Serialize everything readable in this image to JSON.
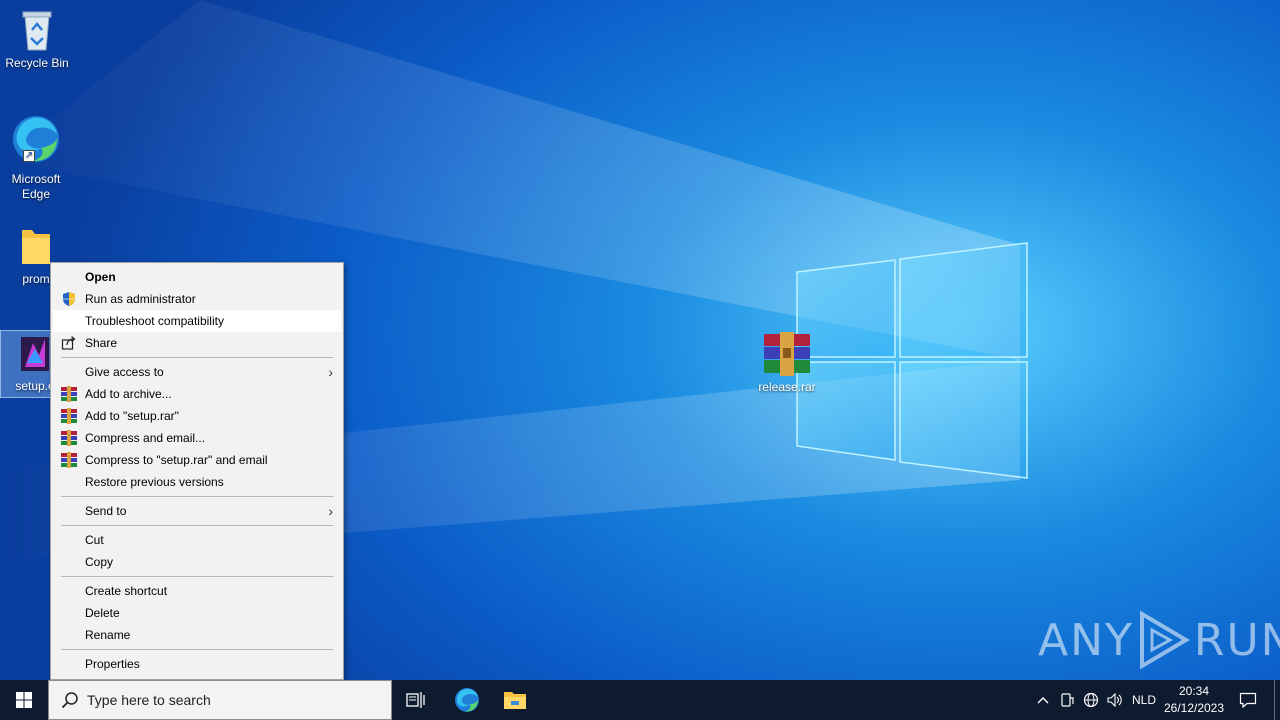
{
  "desktop": {
    "icons": [
      {
        "label": "Recycle Bin"
      },
      {
        "label": "Microsoft Edge"
      },
      {
        "label": "prom"
      },
      {
        "label": "setup.e"
      },
      {
        "label": "release.rar"
      }
    ]
  },
  "context_menu": {
    "items": [
      {
        "label": "Open",
        "icon": null
      },
      {
        "label": "Run as administrator",
        "icon": "uac-shield-icon"
      },
      {
        "label": "Troubleshoot compatibility",
        "icon": null,
        "highlighted": true
      },
      {
        "label": "Share",
        "icon": "share-icon"
      },
      {
        "label": "Give access to",
        "icon": null,
        "submenu": true
      },
      {
        "label": "Add to archive...",
        "icon": "winrar-icon"
      },
      {
        "label": "Add to \"setup.rar\"",
        "icon": "winrar-icon"
      },
      {
        "label": "Compress and email...",
        "icon": "winrar-icon"
      },
      {
        "label": "Compress to \"setup.rar\" and email",
        "icon": "winrar-icon"
      },
      {
        "label": "Restore previous versions",
        "icon": null
      },
      {
        "label": "Send to",
        "icon": null,
        "submenu": true
      },
      {
        "label": "Cut",
        "icon": null
      },
      {
        "label": "Copy",
        "icon": null
      },
      {
        "label": "Create shortcut",
        "icon": null
      },
      {
        "label": "Delete",
        "icon": null
      },
      {
        "label": "Rename",
        "icon": null
      },
      {
        "label": "Properties",
        "icon": null
      }
    ],
    "submenu_arrow": "›"
  },
  "taskbar": {
    "search_placeholder": "Type here to search",
    "language": "NLD",
    "time": "20:34",
    "date": "26/12/2023"
  },
  "watermark": {
    "text_left": "ANY",
    "text_right": "RUN"
  },
  "colors": {
    "menu_bg": "#f2f2f2",
    "taskbar_bg": "#0e1a2e",
    "desktop_accent": "#1a8be0"
  }
}
